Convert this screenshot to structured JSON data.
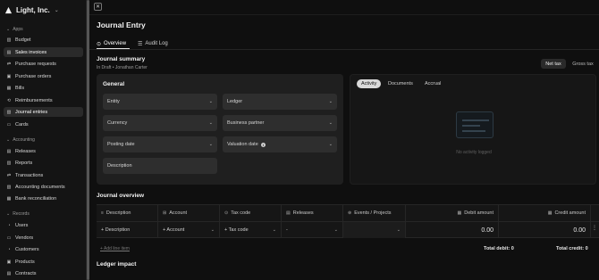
{
  "brand": {
    "name": "Light, Inc.",
    "logo_icon": "light-logo-icon"
  },
  "sidebar": {
    "sections": [
      {
        "label": "Apps",
        "items": [
          {
            "label": "Budget",
            "icon": "budget-icon"
          },
          {
            "label": "Sales invoices",
            "icon": "invoice-icon"
          },
          {
            "label": "Purchase requests",
            "icon": "request-icon"
          },
          {
            "label": "Purchase orders",
            "icon": "order-icon"
          },
          {
            "label": "Bills",
            "icon": "bill-icon"
          },
          {
            "label": "Reimbursements",
            "icon": "reimbursement-icon"
          },
          {
            "label": "Journal entries",
            "icon": "journal-icon"
          },
          {
            "label": "Cards",
            "icon": "card-icon"
          }
        ]
      },
      {
        "label": "Accounting",
        "items": [
          {
            "label": "Releases",
            "icon": "release-icon"
          },
          {
            "label": "Reports",
            "icon": "report-icon"
          },
          {
            "label": "Transactions",
            "icon": "transactions-icon"
          },
          {
            "label": "Accounting documents",
            "icon": "document-icon"
          },
          {
            "label": "Bank reconciliation",
            "icon": "bank-icon"
          }
        ]
      },
      {
        "label": "Records",
        "items": [
          {
            "label": "Users",
            "icon": "user-icon"
          },
          {
            "label": "Vendors",
            "icon": "vendor-icon"
          },
          {
            "label": "Customers",
            "icon": "customer-icon"
          },
          {
            "label": "Products",
            "icon": "product-icon"
          },
          {
            "label": "Contracts",
            "icon": "contract-icon"
          }
        ]
      }
    ],
    "active_item": "Journal entries"
  },
  "page": {
    "title": "Journal Entry",
    "tabs": [
      {
        "label": "Overview",
        "icon": "overview-icon",
        "active": true
      },
      {
        "label": "Audit Log",
        "icon": "list-icon",
        "active": false
      }
    ]
  },
  "summary": {
    "title": "Journal summary",
    "subtitle": "In Draft • Jonathan Carter",
    "toggle": {
      "net": "Net tax",
      "gross": "Gross tax"
    }
  },
  "general": {
    "title": "General",
    "fields": {
      "entity": "Entity",
      "ledger": "Ledger",
      "currency": "Currency",
      "business_partner": "Business partner",
      "posting_date": "Posting date",
      "valuation_date": "Valuation date",
      "description": "Description"
    }
  },
  "activity": {
    "tabs": [
      "Activity",
      "Documents",
      "Accrual"
    ],
    "active_tab": "Activity",
    "empty_text": "No activity logged"
  },
  "overview": {
    "title": "Journal overview",
    "columns": {
      "description": "Description",
      "account": "Account",
      "tax_code": "Tax code",
      "releases": "Releases",
      "events": "Events / Projects",
      "debit": "Debit amount",
      "credit": "Credit amount"
    },
    "row": {
      "description": "+ Description",
      "account": "+ Account",
      "tax_code": "+ Tax code",
      "releases": "-",
      "events": "",
      "debit": "0.00",
      "credit": "0.00"
    },
    "add_line": "+ Add line item",
    "total_debit": "Total debit: 0",
    "total_credit": "Total credit: 0"
  },
  "ledger_impact": {
    "title": "Ledger impact"
  },
  "colors": {
    "background": "#0f0f0f",
    "panel": "#1f1f1f",
    "field": "#2e2e2e",
    "accent": "#d9d9d9"
  }
}
